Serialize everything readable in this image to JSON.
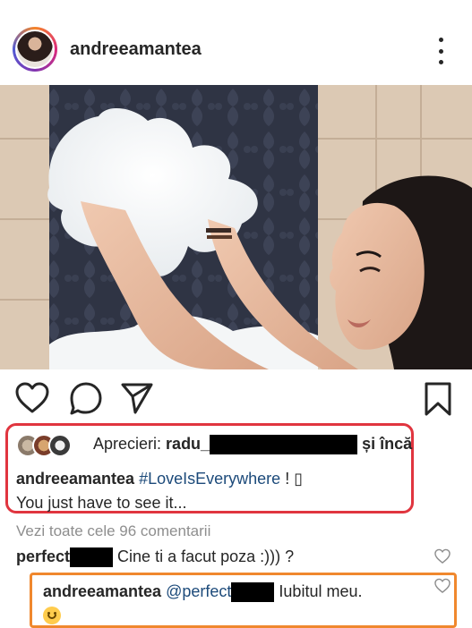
{
  "post": {
    "username": "andreeamantea",
    "likes_prefix": "Aprecieri:",
    "liker_name": "radu_",
    "likes_suffix_and": "și",
    "likes_suffix_more": "încă",
    "caption_user": "andreeamantea",
    "caption_hashtag": "#LoveIsEverywhere",
    "caption_after_hashtag": " ! ",
    "caption_glyph": "▯",
    "caption_line2": "You just have to see it...",
    "view_all_comments": "Vezi toate cele 96 comentarii"
  },
  "comments": [
    {
      "user": "perfect",
      "text": "Cine ti a facut poza :))) ?"
    }
  ],
  "reply": {
    "user": "andreeamantea",
    "mention": "@perfect",
    "text": "Iubitul meu."
  },
  "icons": [
    "avatar",
    "more-options-icon",
    "heart-icon",
    "comment-icon",
    "share-icon",
    "bookmark-icon",
    "like-comment-icon",
    "smiling-emoji"
  ],
  "colors": {
    "highlight_red": "#e0353f",
    "highlight_orange": "#f0882e",
    "hashtag_link": "#1c4a7a",
    "muted_text": "#8e8e8e"
  }
}
